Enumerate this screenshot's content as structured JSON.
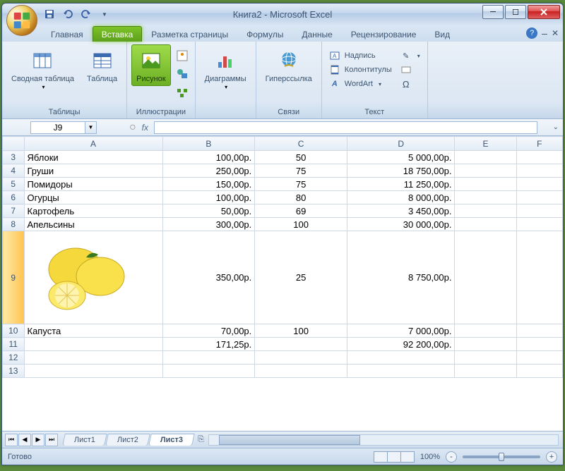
{
  "title": "Книга2 - Microsoft Excel",
  "tabs": [
    "Главная",
    "Вставка",
    "Разметка страницы",
    "Формулы",
    "Данные",
    "Рецензирование",
    "Вид"
  ],
  "active_tab_index": 1,
  "ribbon": {
    "groups": {
      "tables": {
        "label": "Таблицы",
        "pivot": "Сводная\nтаблица",
        "table": "Таблица"
      },
      "illustrations": {
        "label": "Иллюстрации",
        "picture": "Рисунок"
      },
      "charts": {
        "label": "",
        "chart": "Диаграммы"
      },
      "links": {
        "label": "Связи",
        "hyperlink": "Гиперссылка"
      },
      "text": {
        "label": "Текст",
        "textbox": "Надпись",
        "headerfooter": "Колонтитулы",
        "wordart": "WordArt",
        "symbol": "Ω"
      }
    }
  },
  "namebox": "J9",
  "fx_label": "fx",
  "columns": [
    "A",
    "B",
    "C",
    "D",
    "E",
    "F"
  ],
  "row_start": 3,
  "rows": [
    {
      "n": 3,
      "a": "Яблоки",
      "b": "100,00р.",
      "c": "50",
      "d": "5 000,00р."
    },
    {
      "n": 4,
      "a": "Груши",
      "b": "250,00р.",
      "c": "75",
      "d": "18 750,00р."
    },
    {
      "n": 5,
      "a": "Помидоры",
      "b": "150,00р.",
      "c": "75",
      "d": "11 250,00р."
    },
    {
      "n": 6,
      "a": "Огурцы",
      "b": "100,00р.",
      "c": "80",
      "d": "8 000,00р."
    },
    {
      "n": 7,
      "a": "Картофель",
      "b": "50,00р.",
      "c": "69",
      "d": "3 450,00р."
    },
    {
      "n": 8,
      "a": "Апельсины",
      "b": "300,00р.",
      "c": "100",
      "d": "30 000,00р."
    },
    {
      "n": 9,
      "a": "",
      "b": "350,00р.",
      "c": "25",
      "d": "8 750,00р.",
      "image": true
    },
    {
      "n": 10,
      "a": "Капуста",
      "b": "70,00р.",
      "c": "100",
      "d": "7 000,00р."
    },
    {
      "n": 11,
      "a": "",
      "b": "171,25р.",
      "c": "",
      "d": "92 200,00р."
    },
    {
      "n": 12,
      "a": "",
      "b": "",
      "c": "",
      "d": ""
    },
    {
      "n": 13,
      "a": "",
      "b": "",
      "c": "",
      "d": ""
    }
  ],
  "sheets": [
    "Лист1",
    "Лист2",
    "Лист3"
  ],
  "active_sheet_index": 2,
  "status": "Готово",
  "zoom": "100%"
}
